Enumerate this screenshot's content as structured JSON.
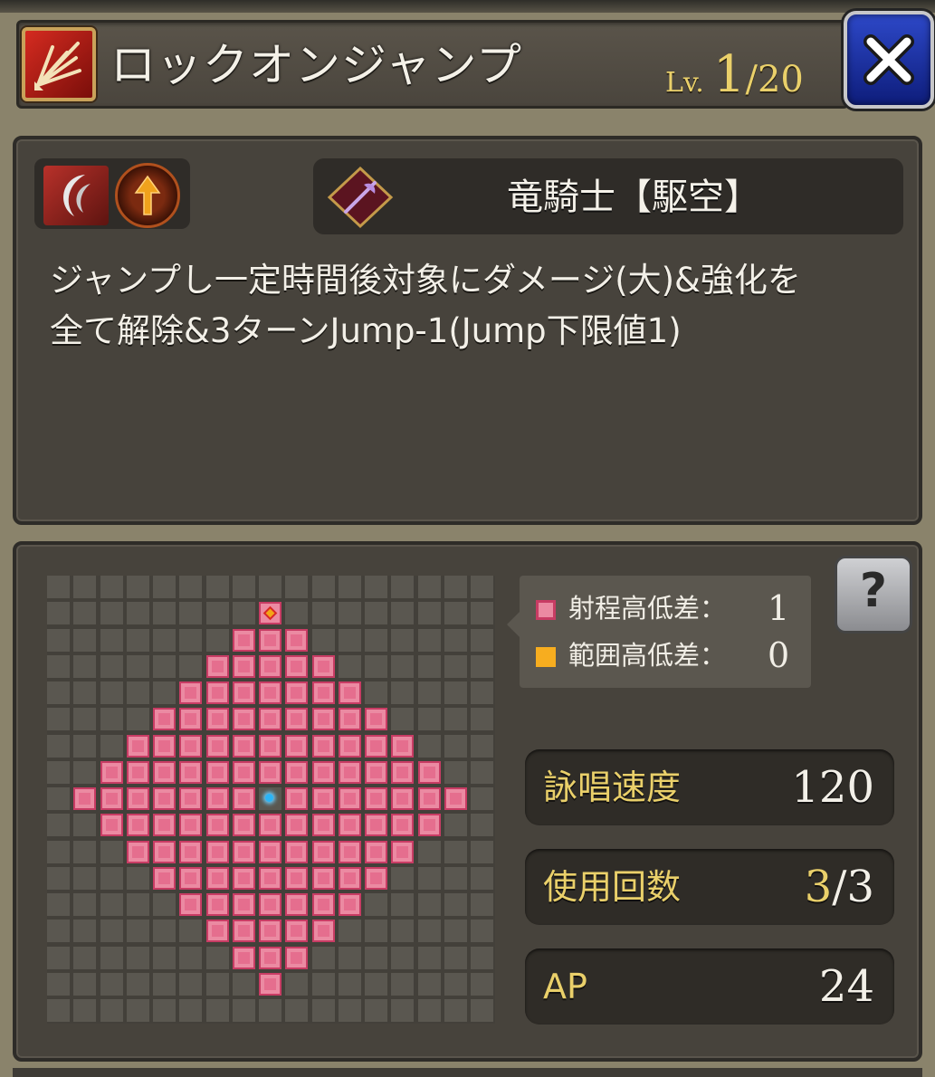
{
  "header": {
    "skill_name": "ロックオンジャンプ",
    "level_label": "Lv.",
    "level_current": "1",
    "level_max": "/20",
    "skill_type_icon": "slash-burst-icon",
    "close_icon": "close-icon"
  },
  "detail": {
    "element_icons": [
      "crescent-slash-icon",
      "arrow-up-orb-icon"
    ],
    "job_icon": "dragoon-polearm-icon",
    "job_name": "竜騎士【駆空】",
    "description": "ジャンプし一定時間後対象にダメージ(大)&強化を全て解除&3ターンJump-1(Jump下限値1)"
  },
  "range": {
    "grid_size": 17,
    "shape": "diamond",
    "range_radius": 7,
    "caster_cell": [
      8,
      8
    ],
    "target_cell": [
      8,
      1
    ],
    "legend": [
      {
        "label": "射程高低差：",
        "value": "1",
        "swatch": "#eb8aa2"
      },
      {
        "label": "範囲高低差：",
        "value": "0",
        "swatch": "#f7ad1f"
      }
    ],
    "help_label": "?",
    "help_icon": "help-book-icon"
  },
  "stats": [
    {
      "label": "詠唱速度",
      "value": "120"
    },
    {
      "label": "使用回数",
      "current": "3",
      "max": "/3"
    },
    {
      "label": "AP",
      "value": "24"
    }
  ],
  "colors": {
    "range_cell": "#eb8aa2",
    "range_border": "#c83c64",
    "caster_marker": "#2ab4f6",
    "target_marker": "#f3a516",
    "accent_gold": "#ead06a",
    "close_button": "#1c33a6"
  }
}
